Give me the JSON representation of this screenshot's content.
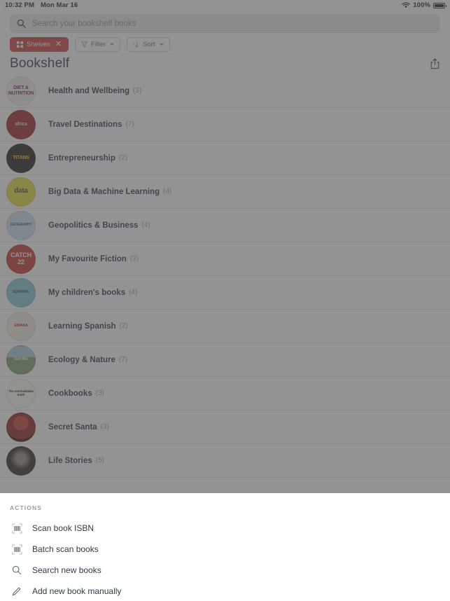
{
  "statusbar": {
    "time": "10:32 PM",
    "date": "Mon Mar 16",
    "battery_percent": "100%",
    "wifi_icon": "wifi-icon",
    "battery_icon": "battery-full-icon"
  },
  "search": {
    "placeholder": "Search your bookshelf books",
    "value": "",
    "icon": "search-icon"
  },
  "toolbar": {
    "shelves_label": "Shelves",
    "shelves_clear_icon": "close-icon",
    "shelves_icon": "grid-icon",
    "filter_label": "Filter",
    "filter_icon": "funnel-icon",
    "sort_label": "Sort",
    "sort_icon": "sort-ascending-icon",
    "caret_icon": "chevron-down-icon"
  },
  "page": {
    "title": "Bookshelf",
    "share_icon": "share-icon"
  },
  "shelves": [
    {
      "name": "Health and Wellbeing",
      "count": "(3)",
      "cover_text": "DIET & NUTRITION",
      "bg": "#f3f1ea",
      "fg": "#6b2d5c"
    },
    {
      "name": "Travel Destinations",
      "count": "(7)",
      "cover_text": "africa",
      "bg": "#9e1f22",
      "fg": "#f2d7a0"
    },
    {
      "name": "Entrepreneurship",
      "count": "(2)",
      "cover_text": "TITANS",
      "bg": "#1a1a1a",
      "fg": "#f2c230"
    },
    {
      "name": "Big Data & Machine Learning",
      "count": "(4)",
      "cover_text": "data",
      "bg": "#e8de3c",
      "fg": "#4a4a1c"
    },
    {
      "name": "Geopolitics & Business",
      "count": "(4)",
      "cover_text": "GEOGRAPHY",
      "bg": "#cfe3ee",
      "fg": "#2a5878"
    },
    {
      "name": "My Favourite Fiction",
      "count": "(3)",
      "cover_text": "CATCH 22",
      "bg": "#c5342c",
      "fg": "#ffffff"
    },
    {
      "name": "My children's books",
      "count": "(4)",
      "cover_text": "SQUIRREL",
      "bg": "#7fc8d6",
      "fg": "#2d4a52"
    },
    {
      "name": "Learning Spanish",
      "count": "(2)",
      "cover_text": "ESPANA",
      "bg": "#f2efe6",
      "fg": "#c8102e"
    },
    {
      "name": "Ecology & Nature",
      "count": "(7)",
      "cover_text": "NATURE",
      "bg": "#7d9b6a",
      "fg": "#f0f4e8"
    },
    {
      "name": "Cookbooks",
      "count": "(3)",
      "cover_text": "The Uninhabitable Earth",
      "bg": "#fbfbf9",
      "fg": "#2b2b2b"
    },
    {
      "name": "Secret Santa",
      "count": "(3)",
      "cover_text": "",
      "bg": "#8e1b18",
      "fg": "#3a0d0b"
    },
    {
      "name": "Life Stories",
      "count": "(5)",
      "cover_text": "",
      "bg": "#2a2622",
      "fg": "#8a7a6a"
    }
  ],
  "sheet": {
    "heading": "ACTIONS",
    "items": [
      {
        "label": "Scan book ISBN",
        "icon": "barcode-scan-icon"
      },
      {
        "label": "Batch scan books",
        "icon": "barcode-scan-icon"
      },
      {
        "label": "Search new books",
        "icon": "search-icon"
      },
      {
        "label": "Add new book manually",
        "icon": "pencil-icon"
      }
    ]
  },
  "colors": {
    "accent": "#c73a3a",
    "text": "#2f3542",
    "muted": "#9b9ea4",
    "scrim": "#505050"
  }
}
